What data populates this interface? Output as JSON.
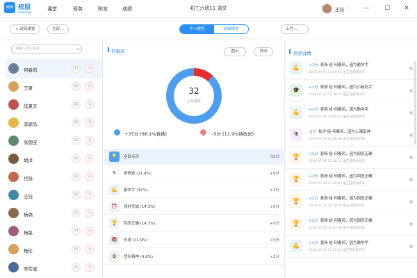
{
  "app": {
    "logo_text": "ICO",
    "name": "校朋",
    "sub": "xiaopeng"
  },
  "nav": [
    {
      "label": "课堂"
    },
    {
      "label": "班务"
    },
    {
      "label": "附言"
    },
    {
      "label": "成绩"
    }
  ],
  "header": {
    "title": "初三六班11 语文",
    "user_name": "王钰"
  },
  "window_controls": {
    "minimize": "—",
    "maximize": "☐",
    "close": "✕"
  },
  "toolbar": {
    "back_label": "< 返回课堂",
    "filter_all": "全部 ⌄",
    "tabs": [
      {
        "label": "个人报告"
      },
      {
        "label": "班级报告"
      }
    ],
    "period": "上月 ⌄"
  },
  "search": {
    "placeholder": "请输入学生姓名"
  },
  "students": [
    {
      "name": "何春风",
      "pos": "37",
      "neg": "-1",
      "avatar_color": "#6a7fa0",
      "selected": true
    },
    {
      "name": "王箫",
      "pos": "31",
      "neg": "-1",
      "avatar_color": "#d9a05b"
    },
    {
      "name": "陆夏天",
      "pos": "25",
      "neg": "-1",
      "avatar_color": "#c0504d"
    },
    {
      "name": "李颖岛",
      "pos": "25",
      "neg": "-1",
      "avatar_color": "#e8b54a"
    },
    {
      "name": "张国宝",
      "pos": "26",
      "neg": "-2",
      "avatar_color": "#5b8a6a"
    },
    {
      "name": "胡洋",
      "pos": "21",
      "neg": "-1",
      "avatar_color": "#7a5a3a"
    },
    {
      "name": "代钱",
      "pos": "21",
      "neg": "-1",
      "avatar_color": "#c46a4a"
    },
    {
      "name": "王钰",
      "pos": "21",
      "neg": "-1",
      "avatar_color": "#3a8aa0"
    },
    {
      "name": "杨璐",
      "pos": "21",
      "neg": "-1",
      "avatar_color": "#8a6a4a"
    },
    {
      "name": "杨磊",
      "pos": "23",
      "neg": "-1",
      "avatar_color": "#a05a7a"
    },
    {
      "name": "杨伦",
      "pos": "22",
      "neg": "-1",
      "avatar_color": "#d9a05b"
    },
    {
      "name": "李苟宝",
      "pos": "21",
      "neg": "-1",
      "avatar_color": "#4a6a9a"
    }
  ],
  "report": {
    "student": "何春风",
    "btn_chart": "图示",
    "btn_export": "导出",
    "score": "32",
    "score_label": "上月得分",
    "positive_text": "+37分 (88.1%表扬)",
    "negative_text": "-5分 (11.9%待改进)",
    "positive_fraction": 0.881,
    "colors": {
      "positive": "#4c9ff0",
      "negative": "#e02e2e"
    }
  },
  "categories": [
    {
      "label": "全部点评",
      "value": "32分",
      "icon": "💡",
      "bg": "#4c9ff0"
    },
    {
      "label": "爱喝迹 (21.4%)",
      "value": "+9分",
      "icon": "✎",
      "bg": "#ffffff"
    },
    {
      "label": "勤学手 (15%)",
      "value": "+3分",
      "icon": "💪",
      "bg": "#e8f2fc"
    },
    {
      "label": "按时完成 (14.3%)",
      "value": "+5分",
      "icon": "⏰",
      "bg": "#eef3f8"
    },
    {
      "label": "回答正确 (14.3%)",
      "value": "+5分",
      "icon": "🏆",
      "bg": "#eef3f8"
    },
    {
      "label": "乐观 (11.9%)",
      "value": "+5分",
      "icon": "📚",
      "bg": "#f6f0ea"
    },
    {
      "label": "团队精神 (4.8%)",
      "value": "+2分",
      "icon": "⚙",
      "bg": "#f3eee8"
    }
  ],
  "comments_title": "点评详情",
  "comments": [
    {
      "pts": "+1分",
      "type": "pos",
      "text": "表扬 给 何春风，因为勤学手",
      "time": "2018-09-30 14:49:43 由王钰老师点评",
      "icon": "💪",
      "bg": "#e8f2fc"
    },
    {
      "pts": "+1分",
      "type": "pos",
      "text": "表扬 给 何春风，因为小板助手",
      "time": "2018-07-27 11:28:27 由王钰老师点评",
      "icon": "🎓",
      "bg": "#e7f3e7"
    },
    {
      "pts": "+1分",
      "type": "pos",
      "text": "表扬 给 何春风，因为勤学手",
      "time": "2018-07-26 14:46:53 由王钰老师点评",
      "icon": "💪",
      "bg": "#e8f2fc"
    },
    {
      "pts": "-2分",
      "type": "neg",
      "text": "批评 给 何春风，因为上课走神",
      "time": "2018-07-26 11:38:08 由王钰老师点评",
      "icon": "⚗",
      "bg": "#f5eef8"
    },
    {
      "pts": "+1分",
      "type": "pos",
      "text": "表扬 给 何春风，因为回答正确",
      "time": "2018-07-26 11:38:21 由王钰老师点评",
      "icon": "🏆",
      "bg": "#fdf4e4"
    },
    {
      "pts": "+1分",
      "type": "pos",
      "text": "表扬 给 何春风，因为回答正确",
      "time": "2018-07-26 11:38:33 由王钰老师点评",
      "icon": "🏆",
      "bg": "#fdf4e4"
    },
    {
      "pts": "+1分",
      "type": "pos",
      "text": "表扬 给 何春风，因为回答正确",
      "time": "2018-07-25 11:29:29 由王钰老师点评",
      "icon": "🏆",
      "bg": "#fdf4e4"
    },
    {
      "pts": "+1分",
      "type": "pos",
      "text": "表扬 给 何春风，因为回答正确",
      "time": "2018-07-25 11:27:49 由王钰老师点评",
      "icon": "🏆",
      "bg": "#fdf4e4"
    },
    {
      "pts": "+1分",
      "type": "pos",
      "text": "表扬 给 何春风，因为勤学手",
      "time": "2018-07-25 11:15:12 由王钰老师点评",
      "icon": "💪",
      "bg": "#e8f2fc"
    }
  ]
}
